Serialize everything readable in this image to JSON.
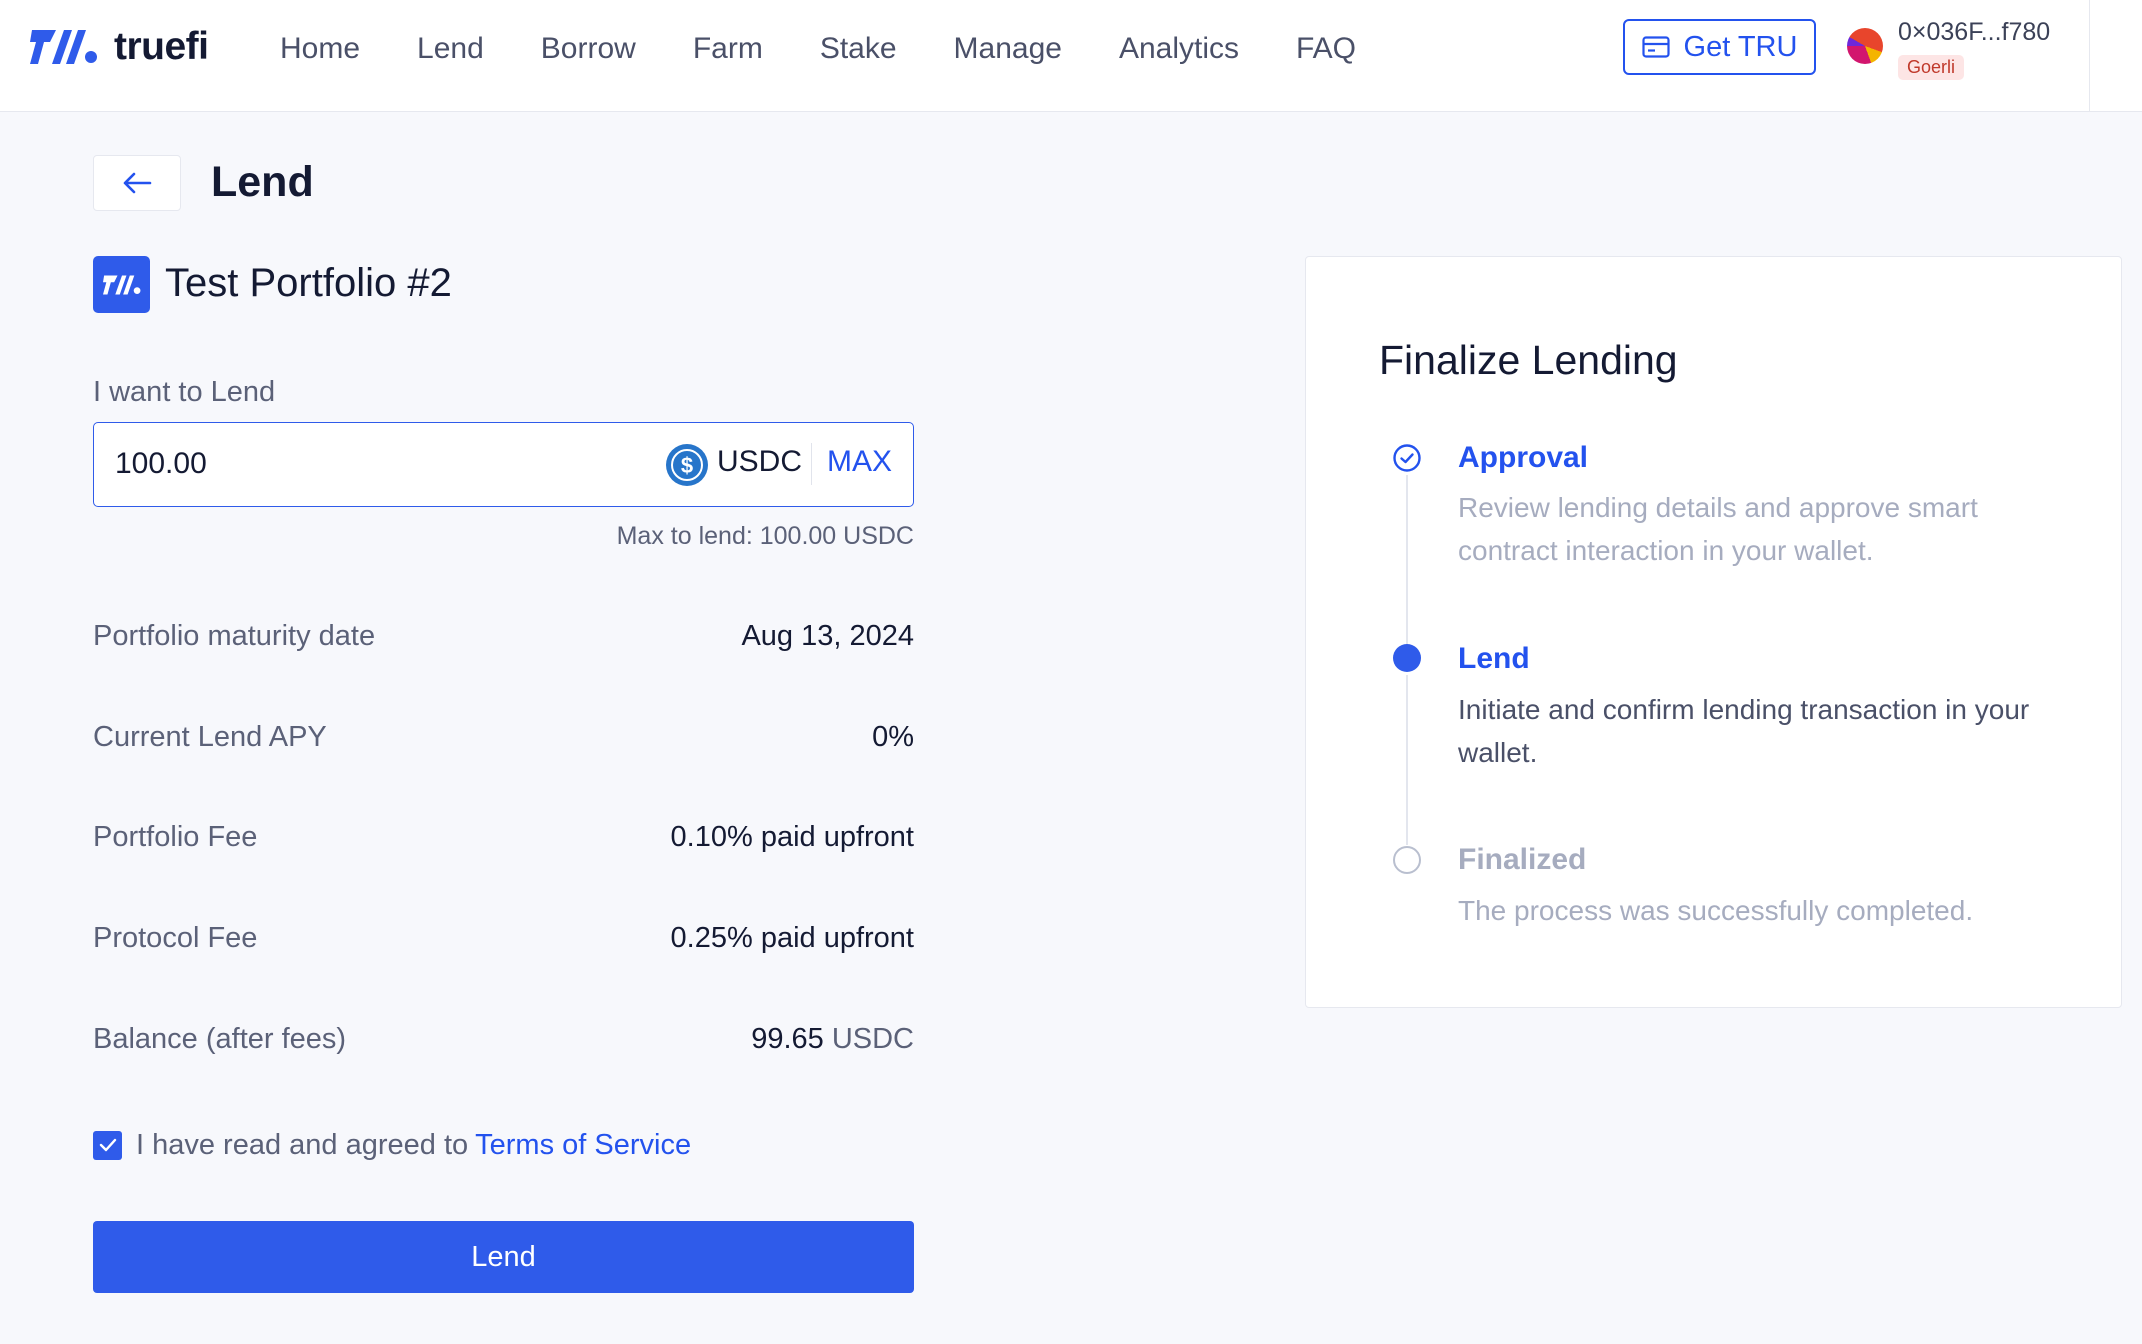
{
  "brand": {
    "name": "truefi"
  },
  "nav": {
    "items": [
      {
        "label": "Home"
      },
      {
        "label": "Lend"
      },
      {
        "label": "Borrow"
      },
      {
        "label": "Farm"
      },
      {
        "label": "Stake"
      },
      {
        "label": "Manage"
      },
      {
        "label": "Analytics"
      },
      {
        "label": "FAQ"
      }
    ]
  },
  "header": {
    "get_tru_label": "Get TRU",
    "get_tru_icon": "card-icon",
    "wallet_address": "0×036F...f780",
    "network": "Goerli"
  },
  "page": {
    "title": "Lend",
    "back_icon": "arrow-left-icon"
  },
  "portfolio": {
    "name": "Test Portfolio #2"
  },
  "form": {
    "amount_label": "I want to Lend",
    "amount_value": "100.00",
    "token": "USDC",
    "max_label": "MAX",
    "max_hint": "Max to lend: 100.00 USDC",
    "details": [
      {
        "label": "Portfolio maturity date",
        "value": "Aug 13, 2024"
      },
      {
        "label": "Current Lend APY",
        "value": "0%"
      },
      {
        "label": "Portfolio Fee",
        "value": "0.10% paid upfront"
      },
      {
        "label": "Protocol Fee",
        "value": "0.25% paid upfront"
      }
    ],
    "balance": {
      "label": "Balance (after fees)",
      "value": "99.65",
      "unit": "USDC"
    },
    "tos": {
      "checked": true,
      "text": "I have read and agreed to",
      "link": "Terms of Service"
    },
    "submit_label": "Lend"
  },
  "finalize": {
    "title": "Finalize Lending",
    "steps": [
      {
        "title": "Approval",
        "description": "Review lending details and approve smart contract interaction in your wallet.",
        "status": "completed"
      },
      {
        "title": "Lend",
        "description": "Initiate and confirm lending transaction in your wallet.",
        "status": "active"
      },
      {
        "title": "Finalized",
        "description": "The process was successfully completed.",
        "status": "pending"
      }
    ]
  },
  "colors": {
    "accent": "#2F5BEA",
    "link": "#2352EE",
    "background": "#F7F8FC",
    "muted_text": "#5B6178",
    "network_badge_bg": "#FDE5E5",
    "network_badge_text": "#C0392B"
  }
}
